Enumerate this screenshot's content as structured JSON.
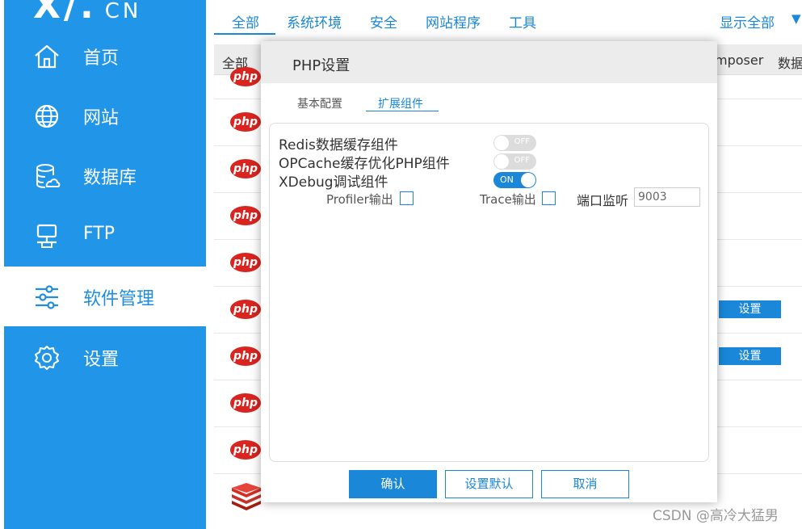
{
  "logo": {
    "main": "X/.",
    "suffix": "CN"
  },
  "sidebar": {
    "items": [
      {
        "label": "首页",
        "icon": "home-icon"
      },
      {
        "label": "网站",
        "icon": "globe-icon"
      },
      {
        "label": "数据库",
        "icon": "database-icon"
      },
      {
        "label": "FTP",
        "icon": "ftp-icon"
      },
      {
        "label": "软件管理",
        "icon": "sliders-icon",
        "active": true
      },
      {
        "label": "设置",
        "icon": "gear-icon"
      }
    ]
  },
  "top_tabs": [
    "全部",
    "系统环境",
    "安全",
    "网站程序",
    "工具"
  ],
  "show_all": "显示全部",
  "sub_tabs": {
    "left": "全部",
    "right1": "mposer",
    "right2": "数据"
  },
  "list": {
    "php_logo_text": "php",
    "set_label": "设置"
  },
  "dialog": {
    "title": "PHP设置",
    "tabs": [
      "基本配置",
      "扩展组件"
    ],
    "active_tab": 1,
    "options": [
      {
        "label": "Redis数据缓存组件",
        "state": "OFF"
      },
      {
        "label": "OPCache缓存优化PHP组件",
        "state": "OFF"
      },
      {
        "label": "XDebug调试组件",
        "state": "ON"
      }
    ],
    "xdebug": {
      "profiler_label": "Profiler输出",
      "trace_label": "Trace输出",
      "port_label": "端口监听",
      "port_value": "9003"
    },
    "buttons": {
      "confirm": "确认",
      "set_default": "设置默认",
      "cancel": "取消"
    }
  },
  "watermark": "CSDN @高冷大猛男",
  "colors": {
    "sidebar": "#2196e8",
    "accent": "#1a87d8",
    "php_red": "#d9241f"
  }
}
